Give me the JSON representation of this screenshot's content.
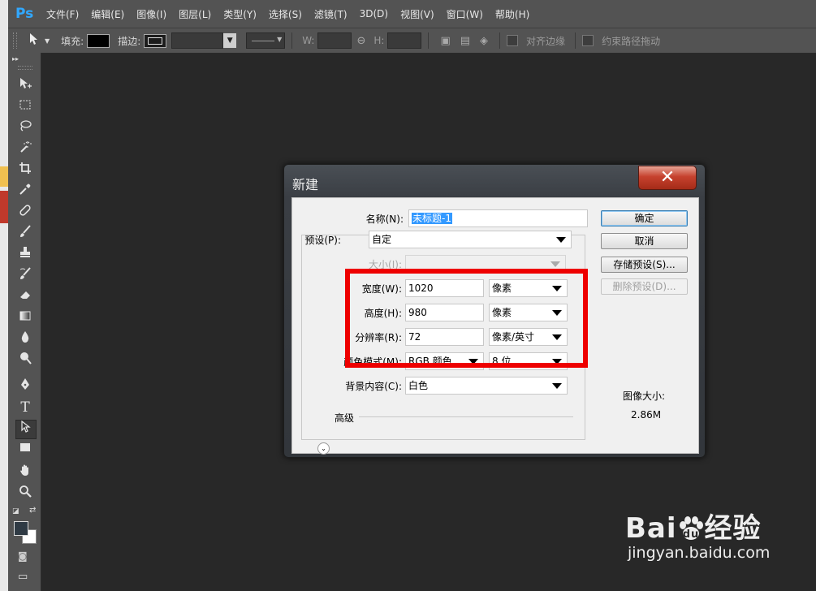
{
  "app": {
    "logo": "Ps",
    "menus": [
      "文件(F)",
      "编辑(E)",
      "图像(I)",
      "图层(L)",
      "类型(Y)",
      "选择(S)",
      "滤镜(T)",
      "3D(D)",
      "视图(V)",
      "窗口(W)",
      "帮助(H)"
    ]
  },
  "options_bar": {
    "fill_label": "填充:",
    "stroke_label": "描边:",
    "w_label": "W:",
    "h_label": "H:",
    "align_edges_label": "对齐边缘",
    "constrain_path_label": "约束路径拖动"
  },
  "toolbar": {
    "tools": [
      "move-icon",
      "marquee-icon",
      "lasso-icon",
      "magic-wand-icon",
      "crop-icon",
      "eyedropper-icon",
      "healing-brush-icon",
      "brush-icon",
      "clone-stamp-icon",
      "history-brush-icon",
      "eraser-icon",
      "gradient-icon",
      "blur-icon",
      "dodge-icon",
      "pen-icon",
      "type-icon",
      "path-select-icon",
      "rectangle-icon",
      "hand-icon",
      "zoom-icon"
    ],
    "type_glyph": "T",
    "foreground_color": "#2f3a44",
    "background_color": "#ffffff"
  },
  "dialog": {
    "title": "新建",
    "close_glyph": "✕",
    "name_label": "名称(N):",
    "name_value": "未标题-1",
    "preset_label": "预设(P):",
    "preset_value": "自定",
    "size_label": "大小(I):",
    "width_label": "宽度(W):",
    "width_value": "1020",
    "width_unit": "像素",
    "height_label": "高度(H):",
    "height_value": "980",
    "height_unit": "像素",
    "resolution_label": "分辨率(R):",
    "resolution_value": "72",
    "resolution_unit": "像素/英寸",
    "color_mode_label": "颜色模式(M):",
    "color_mode_value": "RGB 颜色",
    "bit_depth_value": "8 位",
    "background_label": "背景内容(C):",
    "background_value": "白色",
    "advanced_label": "高级",
    "ok_button": "确定",
    "cancel_button": "取消",
    "save_preset_button": "存储预设(S)...",
    "delete_preset_button": "删除预设(D)...",
    "image_size_label": "图像大小:",
    "image_size_value": "2.86M"
  },
  "watermark": {
    "brand": "Bai",
    "brand_tail": "经验",
    "url": "jingyan.baidu.com"
  },
  "colors": {
    "ps_blue": "#31a8ff",
    "annotation_red": "#ee0000",
    "selection_blue": "#3399ff"
  }
}
